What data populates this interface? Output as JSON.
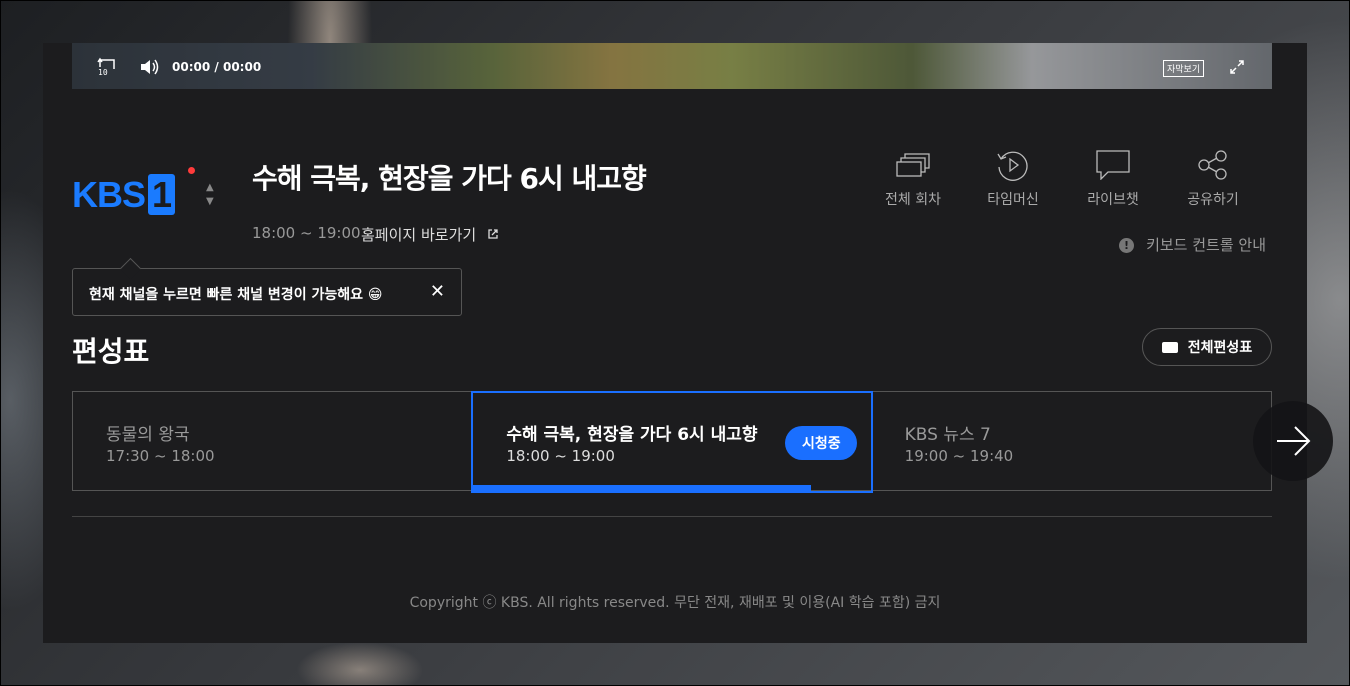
{
  "player": {
    "rewind_label": "10",
    "current_time": "00:00",
    "separator": "/",
    "duration": "00:00",
    "subtitle_label": "자막보기"
  },
  "channel": {
    "logo_text": "KBS",
    "logo_number": "1",
    "accent_color": "#1a7bff",
    "live_dot_color": "#ff3b3b"
  },
  "program": {
    "title": "수해 극복, 현장을 가다 6시 내고향",
    "time": "18:00 ~ 19:00",
    "homepage_link": "홈페이지 바로가기"
  },
  "actions": [
    {
      "label": "전체 회차",
      "icon": "episodes-icon"
    },
    {
      "label": "타임머신",
      "icon": "timemachine-icon"
    },
    {
      "label": "라이브챗",
      "icon": "chat-icon"
    },
    {
      "label": "공유하기",
      "icon": "share-icon"
    }
  ],
  "keyboard_help": "키보드 컨트롤 안내",
  "tooltip": {
    "text": "현재 채널을 누르면 빠른 채널 변경이 가능해요 😁",
    "close": "✕"
  },
  "schedule": {
    "title": "편성표",
    "full_button": "전체편성표",
    "items": [
      {
        "name": "동물의 왕국",
        "time": "17:30 ~ 18:00"
      },
      {
        "name": "수해 극복, 현장을 가다 6시 내고향",
        "time": "18:00 ~ 19:00",
        "badge": "시청중",
        "progress": 0.85
      },
      {
        "name": "KBS 뉴스 7",
        "time": "19:00 ~ 19:40"
      }
    ]
  },
  "copyright": "Copyright ⓒ KBS. All rights reserved. 무단 전재, 재배포 및 이용(AI 학습 포함) 금지"
}
